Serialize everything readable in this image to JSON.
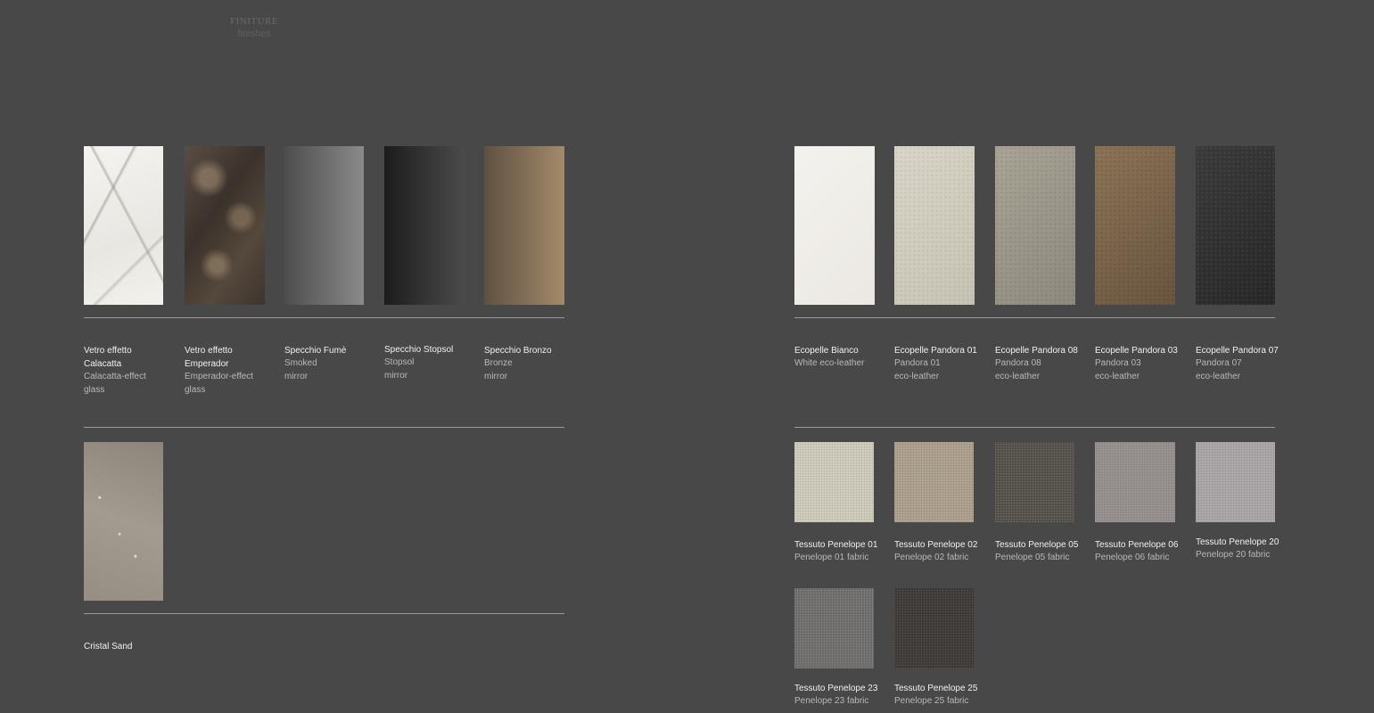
{
  "header": {
    "title": "FINITURE",
    "subtitle": "finishes"
  },
  "glass": {
    "calacatta": {
      "name_1": "Vetro effetto",
      "name_2": "Calacatta",
      "desc_1": "Calacatta-effect",
      "desc_2": "glass"
    },
    "emperador": {
      "name_1": "Vetro effetto",
      "name_2": "Emperador",
      "desc_1": "Emperador-effect",
      "desc_2": "glass"
    },
    "fume": {
      "name": "Specchio Fumè",
      "desc_1": "Smoked",
      "desc_2": "mirror"
    },
    "stopsol": {
      "name": "Specchio Stopsol",
      "desc_1": "Stopsol",
      "desc_2": "mirror"
    },
    "bronzo": {
      "name": "Specchio Bronzo",
      "desc_1": "Bronze",
      "desc_2": "mirror"
    }
  },
  "cristal": {
    "name": "Cristal Sand"
  },
  "leather": {
    "bianco": {
      "name": "Ecopelle Bianco",
      "desc_1": "White eco-leather"
    },
    "p01": {
      "name": "Ecopelle Pandora 01",
      "desc_1": "Pandora 01",
      "desc_2": "eco-leather"
    },
    "p08": {
      "name": "Ecopelle Pandora 08",
      "desc_1": "Pandora 08",
      "desc_2": "eco-leather"
    },
    "p03": {
      "name": "Ecopelle Pandora 03",
      "desc_1": "Pandora 03",
      "desc_2": "eco-leather"
    },
    "p07": {
      "name": "Ecopelle Pandora 07",
      "desc_1": "Pandora 07",
      "desc_2": "eco-leather"
    }
  },
  "fabric": {
    "f01": {
      "name": "Tessuto Penelope 01",
      "desc": "Penelope 01 fabric"
    },
    "f02": {
      "name": "Tessuto Penelope 02",
      "desc": "Penelope 02 fabric"
    },
    "f05": {
      "name": "Tessuto Penelope 05",
      "desc": "Penelope 05 fabric"
    },
    "f06": {
      "name": "Tessuto Penelope 06",
      "desc": "Penelope 06 fabric"
    },
    "f20": {
      "name": "Tessuto Penelope 20",
      "desc": "Penelope 20 fabric"
    },
    "f23": {
      "name": "Tessuto Penelope 23",
      "desc": "Penelope 23 fabric"
    },
    "f25": {
      "name": "Tessuto Penelope 25",
      "desc": "Penelope 25 fabric"
    }
  }
}
